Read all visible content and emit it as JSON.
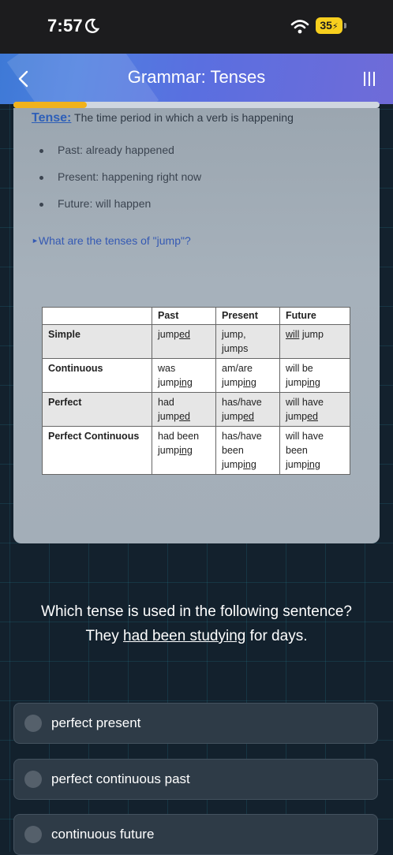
{
  "status_bar": {
    "time": "7:57",
    "battery": "35"
  },
  "header": {
    "title": "Grammar: Tenses"
  },
  "progress": {
    "fraction": 0.2
  },
  "lesson": {
    "term": "Tense:",
    "definition": "The time period in which a verb is happening",
    "bullets": [
      "Past: already happened",
      "Present: happening right now",
      "Future: will happen"
    ],
    "details_label": "What are the tenses of \"jump\"?",
    "table": {
      "headers": [
        "",
        "Past",
        "Present",
        "Future"
      ],
      "rows": [
        {
          "label": "Simple",
          "past": [
            "jump",
            "ed"
          ],
          "present": [
            "jump,",
            "jumps"
          ],
          "future": [
            "will",
            " jump"
          ]
        },
        {
          "label": "Continuous",
          "past": [
            "was",
            "jump",
            "ing"
          ],
          "present": [
            "am/are",
            "jump",
            "ing"
          ],
          "future": [
            "will be",
            "jump",
            "ing"
          ]
        },
        {
          "label": "Perfect",
          "past": [
            "had",
            "jump",
            "ed"
          ],
          "present": [
            "has/have",
            "jump",
            "ed"
          ],
          "future": [
            "will have",
            "jump",
            "ed"
          ]
        },
        {
          "label": "Perfect Continuous",
          "past": [
            "had been",
            "jump",
            "ing"
          ],
          "present": [
            "has/have",
            "been",
            "jump",
            "ing"
          ],
          "future": [
            "will have",
            "been",
            "jump",
            "ing"
          ]
        }
      ]
    }
  },
  "question": {
    "prompt": "Which tense is used in the following sentence?",
    "sentence_before": "They ",
    "sentence_underlined": "had been studying",
    "sentence_after": " for days."
  },
  "options": [
    {
      "label": "perfect present"
    },
    {
      "label": "perfect continuous past"
    },
    {
      "label": "continuous future"
    }
  ],
  "colors": {
    "accent": "#4d7fe0",
    "progress": "#f0b21c",
    "battery": "#f7cf1e"
  }
}
